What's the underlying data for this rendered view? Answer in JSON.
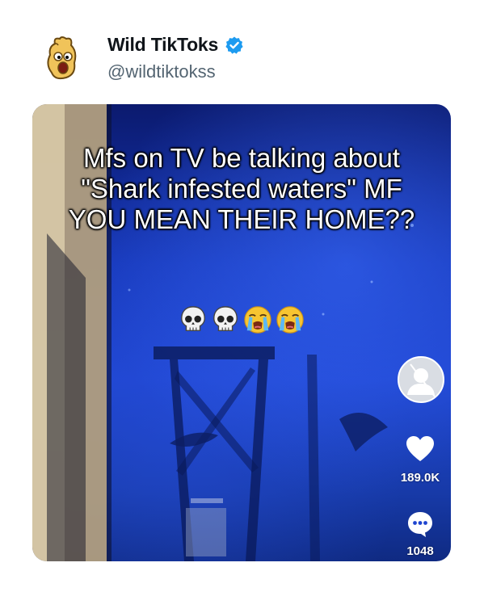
{
  "account": {
    "display_name": "Wild TikToks",
    "handle": "@wildtiktokss",
    "verified": true,
    "avatar_icon": "cartoon-face-avatar",
    "verified_icon": "verified-badge-icon"
  },
  "media": {
    "caption": "Mfs on TV be talking about \"Shark infested waters\" MF YOU MEAN THEIR HOME??",
    "emojis": [
      "skull",
      "skull",
      "loudly-crying-face",
      "loudly-crying-face"
    ],
    "side_avatar_icon": "default-profile-icon",
    "like_icon": "heart-icon",
    "like_count": "189.0K",
    "comment_icon": "comment-bubble-icon",
    "comment_count": "1048"
  },
  "colors": {
    "verified_blue": "#1d9bf0",
    "handle_gray": "#536471",
    "water_blue": "#1e44cf"
  }
}
